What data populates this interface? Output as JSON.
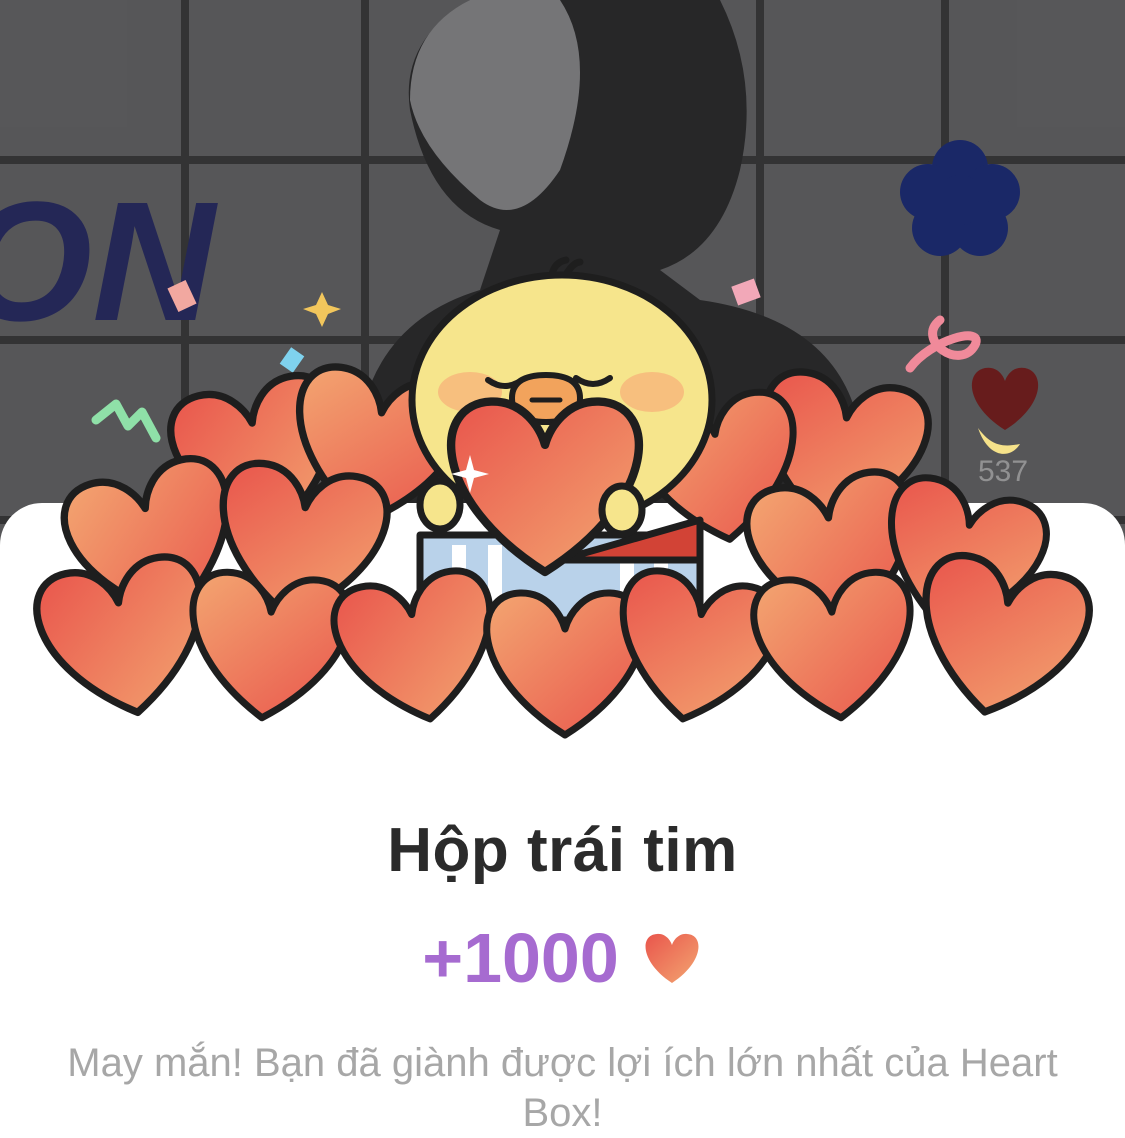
{
  "background": {
    "like_count": "537"
  },
  "sheet": {
    "illustration_icon": "heart-box-chick-illustration",
    "title": "Hộp trái tim",
    "reward": {
      "amount": "+1000",
      "icon": "heart-icon",
      "accent_color": "#a66bd0"
    },
    "description": "May mắn! Bạn đã giành được lợi ích lớn nhất của Heart Box!"
  }
}
